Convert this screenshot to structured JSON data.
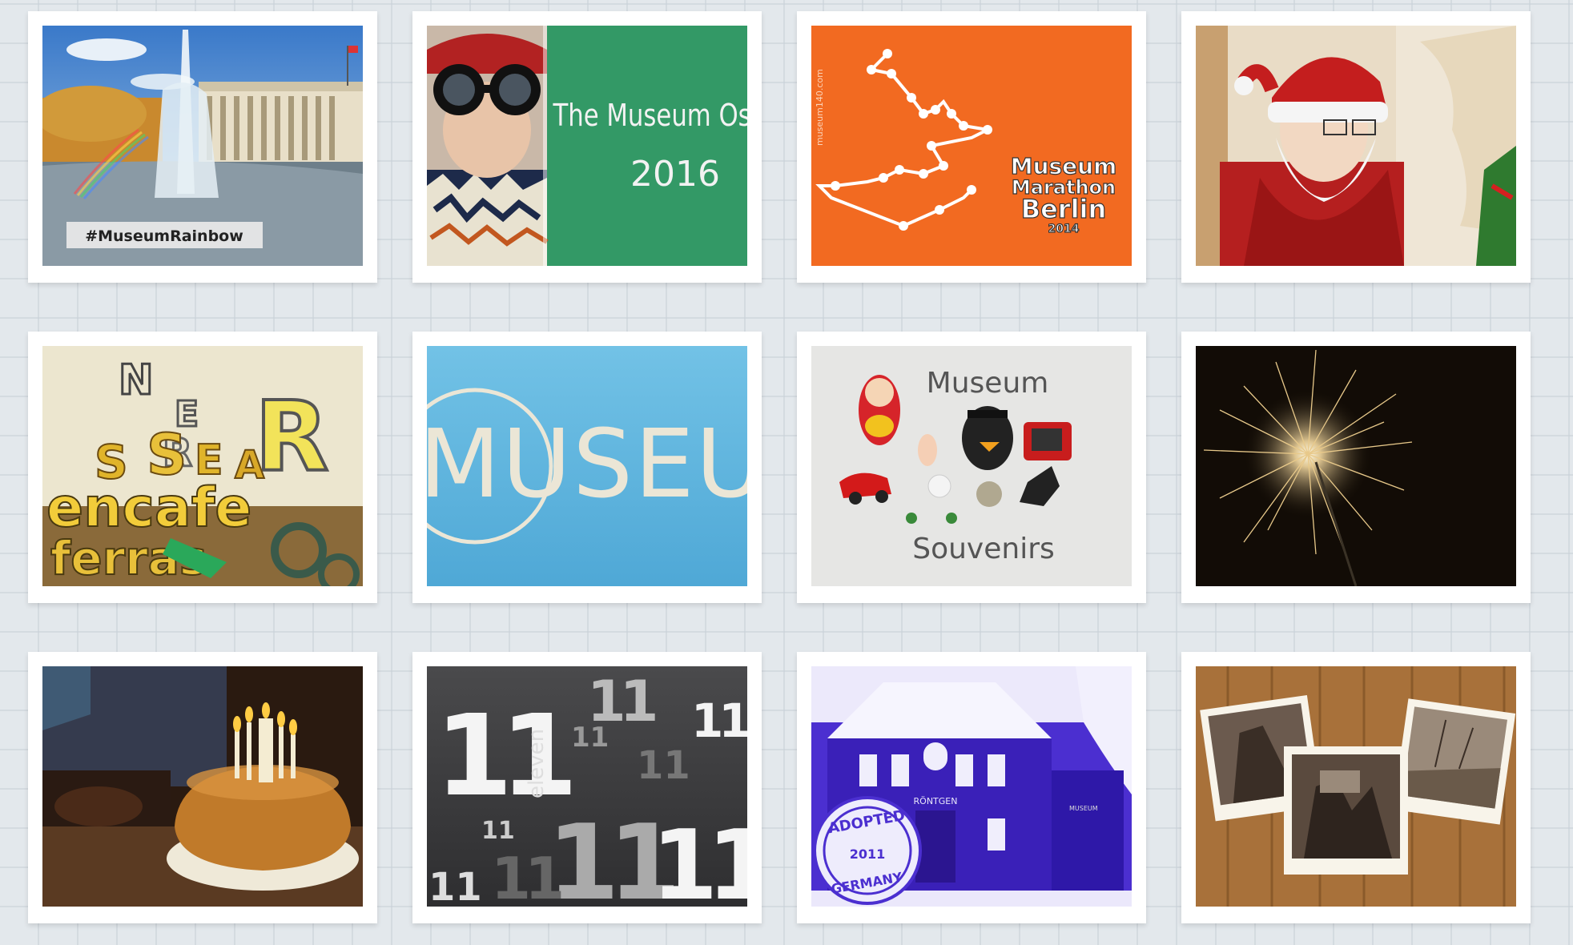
{
  "tiles": [
    {
      "caption": "#MuseumRainbow"
    },
    {
      "line1": "The Museum Osk",
      "line2": "2016"
    },
    {
      "side": "museum140.com",
      "title1": "Museum",
      "title2": "Marathon",
      "title3": "Berlin",
      "year": "2014"
    },
    {},
    {
      "letters": [
        "N",
        "E",
        "R",
        "S",
        "E",
        "S",
        "A",
        "R",
        "encafe",
        "ferras"
      ]
    },
    {
      "word": "MUSEU"
    },
    {
      "top": "Museum",
      "bottom": "Souvenirs"
    },
    {},
    {},
    {
      "big": "11",
      "small": "11",
      "word": "eleven"
    },
    {
      "sign1": "RÖNTGEN",
      "sign2": "MUSEUM",
      "badge1": "ADOPTED",
      "badge2": "2011",
      "badge3": "GERMANY"
    },
    {}
  ],
  "colors": {
    "green": "#339966",
    "orange": "#f26a21",
    "blue": "#63b9df",
    "purple": "#4b2fd0"
  }
}
